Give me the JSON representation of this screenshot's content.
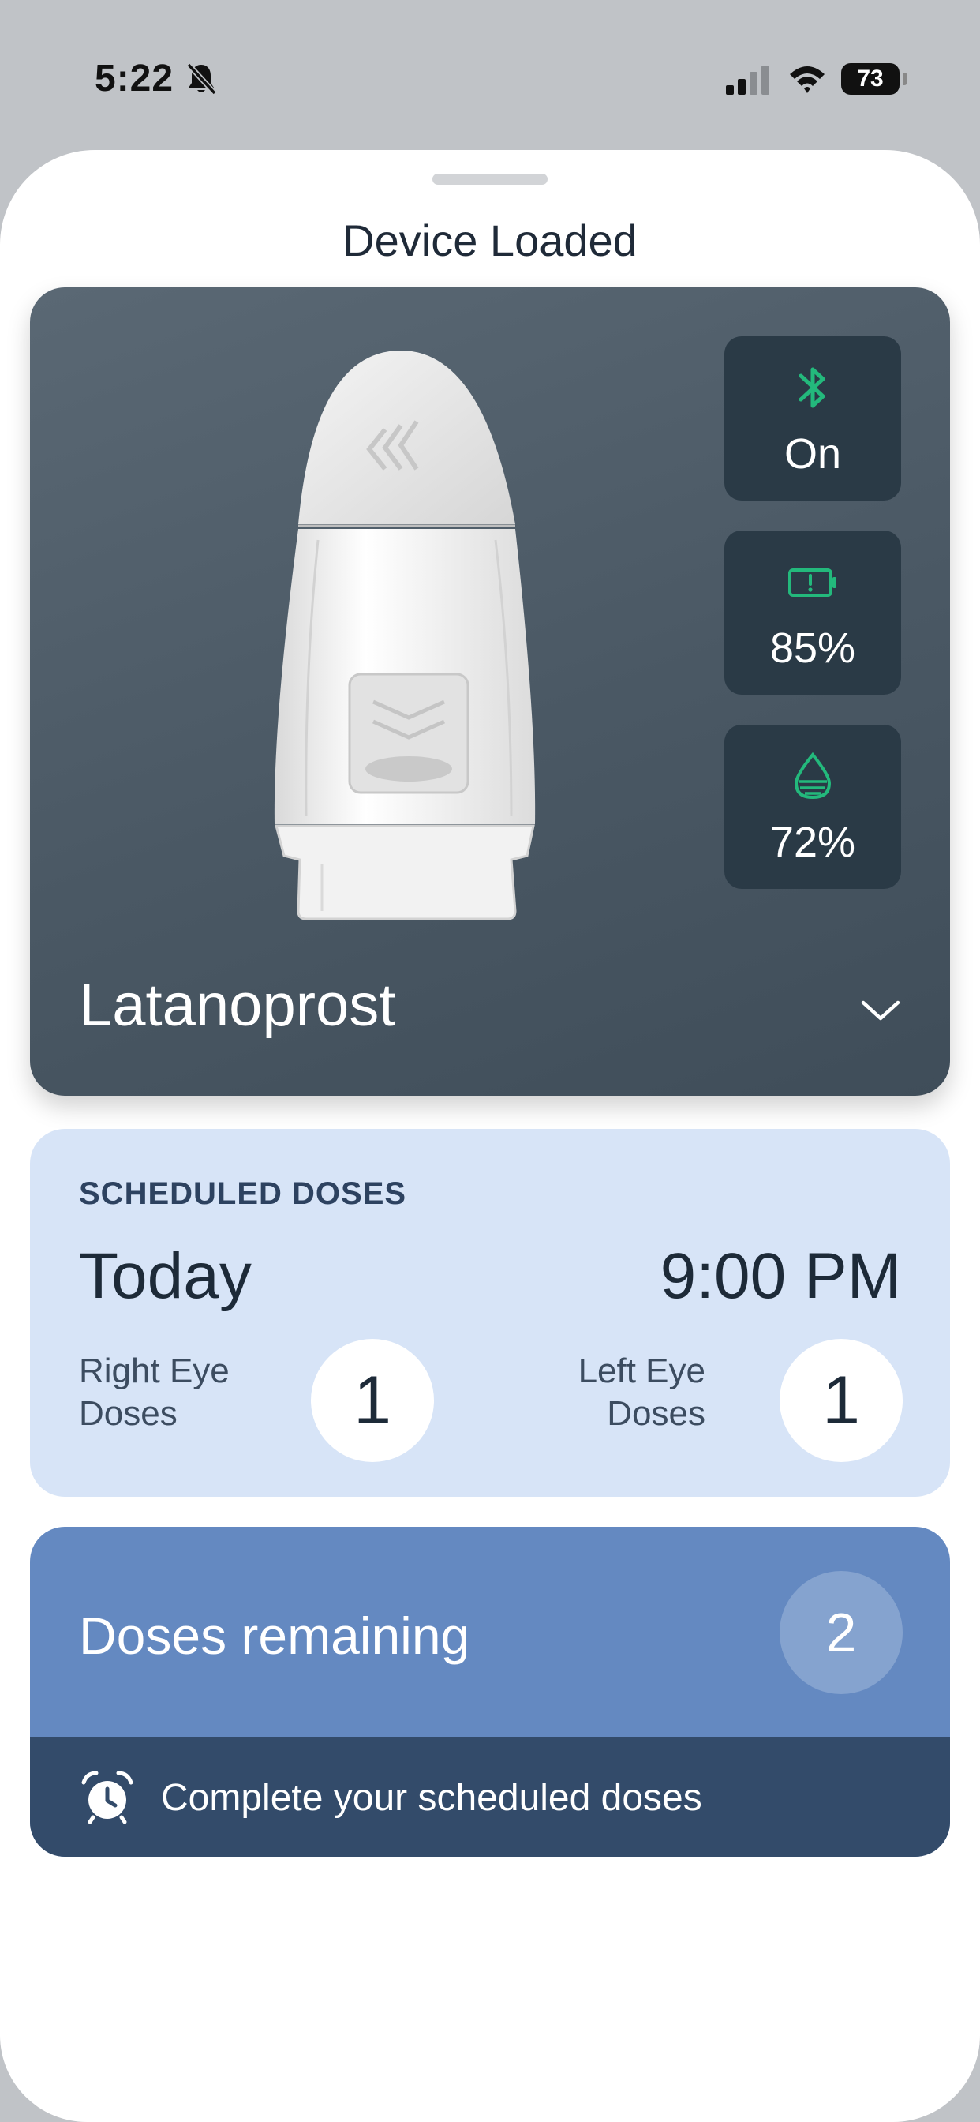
{
  "status_bar": {
    "time": "5:22",
    "battery_level": "73",
    "icons": [
      "bell-slash-icon",
      "cellular-signal-icon",
      "wifi-icon",
      "battery-icon"
    ]
  },
  "sheet": {
    "title": "Device Loaded"
  },
  "device": {
    "name": "Latanoprost",
    "bluetooth": {
      "icon": "bluetooth-icon",
      "value": "On"
    },
    "battery": {
      "icon": "battery-alert-icon",
      "value": "85%"
    },
    "medication_level": {
      "icon": "drop-icon",
      "value": "72%"
    },
    "accent_color": "#23b97c"
  },
  "schedule": {
    "label": "SCHEDULED DOSES",
    "day": "Today",
    "time": "9:00 PM",
    "right_eye": {
      "label_line1": "Right Eye",
      "label_line2": "Doses",
      "count": "1"
    },
    "left_eye": {
      "label_line1": "Left Eye",
      "label_line2": "Doses",
      "count": "1"
    }
  },
  "remaining": {
    "label": "Doses remaining",
    "count": "2",
    "reminder_icon": "alarm-clock-icon",
    "reminder_text": "Complete your scheduled doses"
  }
}
